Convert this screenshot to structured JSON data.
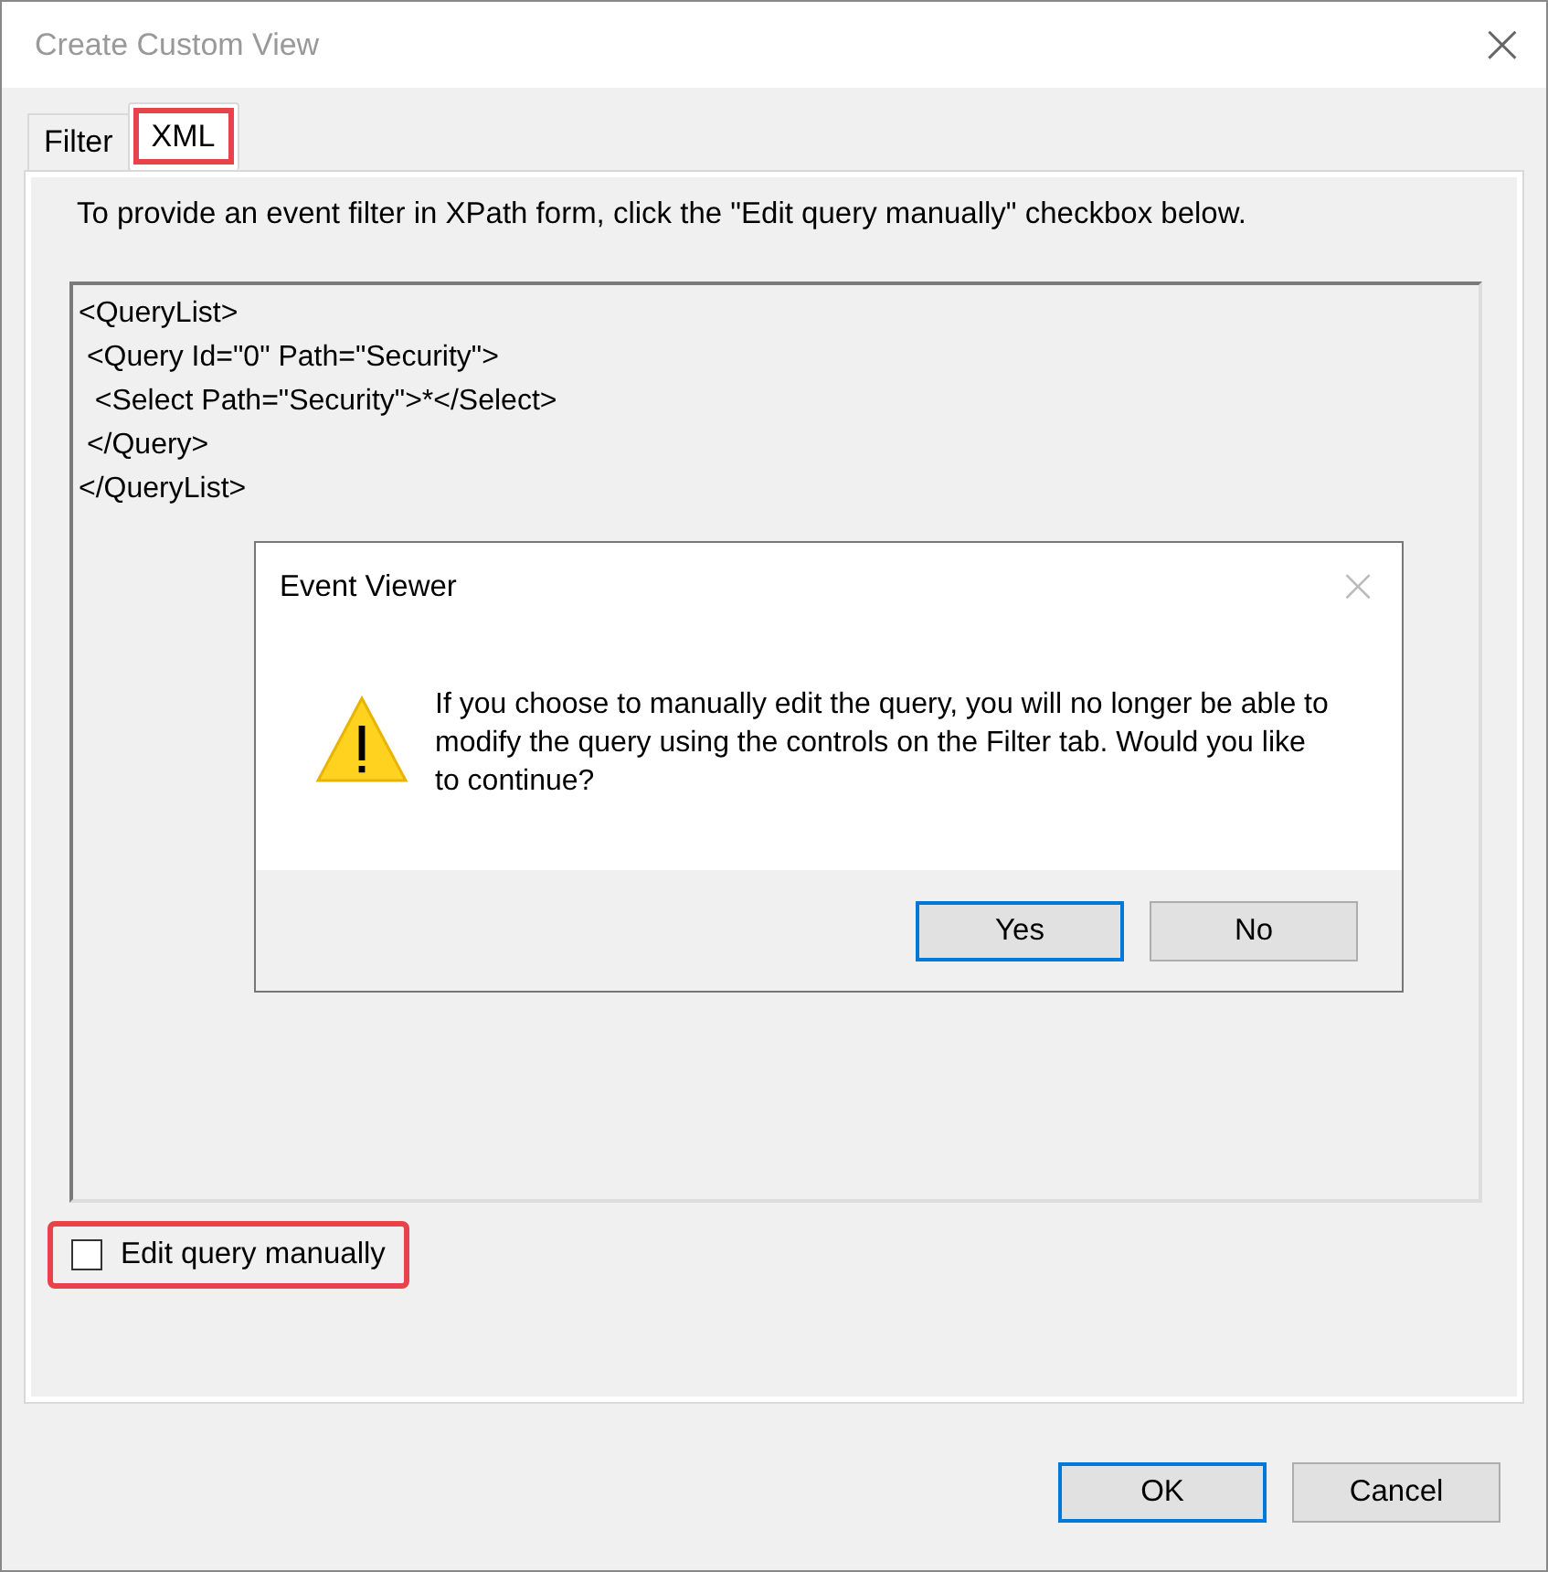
{
  "window": {
    "title": "Create Custom View",
    "close": "×"
  },
  "tabs": [
    {
      "label": "Filter",
      "selected": false,
      "highlighted": false
    },
    {
      "label": "XML",
      "selected": true,
      "highlighted": true
    }
  ],
  "instruction": "To provide an event filter in XPath form, click the \"Edit query manually\" checkbox below.",
  "query_lines": [
    "<QueryList>",
    " <Query Id=\"0\" Path=\"Security\">",
    "  <Select Path=\"Security\">*</Select>",
    " </Query>",
    "</QueryList>"
  ],
  "message_box": {
    "title": "Event Viewer",
    "close": "×",
    "message": "If you choose to manually edit the query, you will no longer be able to modify the query using the controls on the Filter tab. Would you like to continue?",
    "buttons": [
      {
        "label": "Yes",
        "default": true
      },
      {
        "label": "No",
        "default": false
      }
    ]
  },
  "checkbox": {
    "label": "Edit query manually",
    "checked": false,
    "highlighted": true
  },
  "buttons": [
    {
      "label": "OK",
      "default": true
    },
    {
      "label": "Cancel",
      "default": false
    }
  ]
}
